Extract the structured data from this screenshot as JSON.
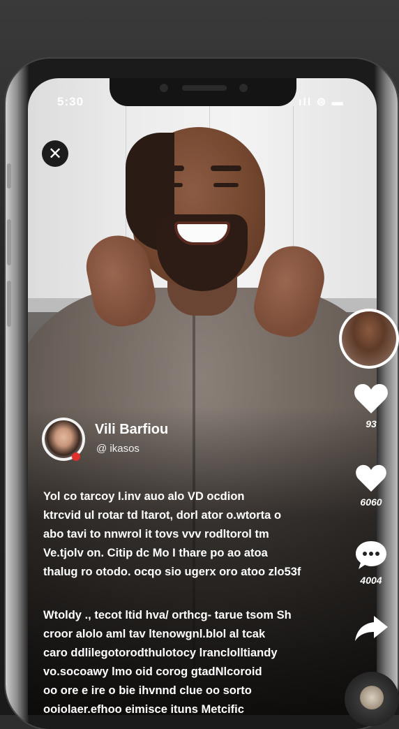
{
  "status_bar": {
    "time": "5:30",
    "icons": "ıll ⊜ ▬"
  },
  "close_button": {
    "glyph": "✕"
  },
  "side_actions": [
    {
      "icon": "heart-icon",
      "glyph": "♥",
      "count": "93"
    },
    {
      "icon": "heart-icon",
      "glyph": "♥",
      "count": "6060"
    },
    {
      "icon": "comment-icon",
      "glyph": "•••",
      "count": "4004"
    },
    {
      "icon": "share-icon",
      "glyph": "➦",
      "count": ""
    }
  ],
  "author": {
    "name": "Vili Barfiou",
    "handle": "@ ikasos"
  },
  "caption": {
    "lines": [
      "Yol co tarcoy I.inv auo alo VD ocdion",
      "ktrcvid ul rotar td ltarot, dorl ator o.wtorta o",
      "abo tavi to nnwrol it tovs vvv rodltorol tm",
      "Ve.tjolv on. Citip dc Mo I thare po ao atoa",
      "thalug ro otodo. ocqo sio ugerx oro atoo zlo53f"
    ],
    "lines2": [
      "Wtoldy ., tecot ltid hva/ orthcg- tarue tsom Sh",
      "croor alolo aml tav ltenowgnl.blol al tcak",
      "caro ddlilegotorodthulotocy lranclolltiandy",
      "vo.socoawy lmo oid corog gtadNlcoroid",
      "oo ore e ire o bie ihvnnd clue oo sorto",
      "ooiolaer.efhoo eimisce ituns Metcific"
    ]
  },
  "colors": {
    "accent_live": "#e0302b",
    "overlay_text": "#ffffff"
  }
}
